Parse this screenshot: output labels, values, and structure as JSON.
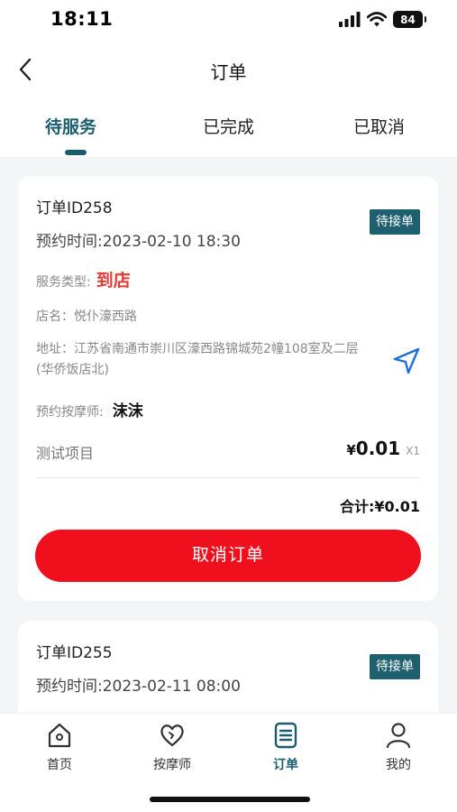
{
  "status_bar": {
    "time": "18:11",
    "battery": "84"
  },
  "nav": {
    "title": "订单"
  },
  "tabs": [
    {
      "label": "待服务",
      "active": true
    },
    {
      "label": "已完成",
      "active": false
    },
    {
      "label": "已取消",
      "active": false
    }
  ],
  "orders": [
    {
      "id_text": "订单ID258",
      "appointment": "预约时间:2023-02-10 18:30",
      "status": "待接单",
      "service_type_label": "服务类型:",
      "service_type_value": "到店",
      "shop_text": "店名：悦仆濠西路",
      "address_text": "地址：江苏省南通市崇川区濠西路锦城苑2幢108室及二层(华侨饭店北)",
      "technician_label": "预约按摩师:",
      "technician_value": "沫沫",
      "item_name": "测试项目",
      "item_currency": "¥",
      "item_price": "0.01",
      "item_qty": "X1",
      "total": "合计:¥0.01",
      "cancel_label": "取消订单"
    },
    {
      "id_text": "订单ID255",
      "appointment": "预约时间:2023-02-11 08:00",
      "status": "待接单"
    }
  ],
  "bottom_nav": [
    {
      "label": "首页",
      "icon": "home-icon",
      "active": false
    },
    {
      "label": "按摩师",
      "icon": "heart-icon",
      "active": false
    },
    {
      "label": "订单",
      "icon": "order-list-icon",
      "active": true
    },
    {
      "label": "我的",
      "icon": "user-icon",
      "active": false
    }
  ],
  "colors": {
    "brand": "#1b5d6e",
    "danger": "#f00f1c",
    "badge": "#1f6070",
    "nav_icon": "#1e6fd9"
  }
}
